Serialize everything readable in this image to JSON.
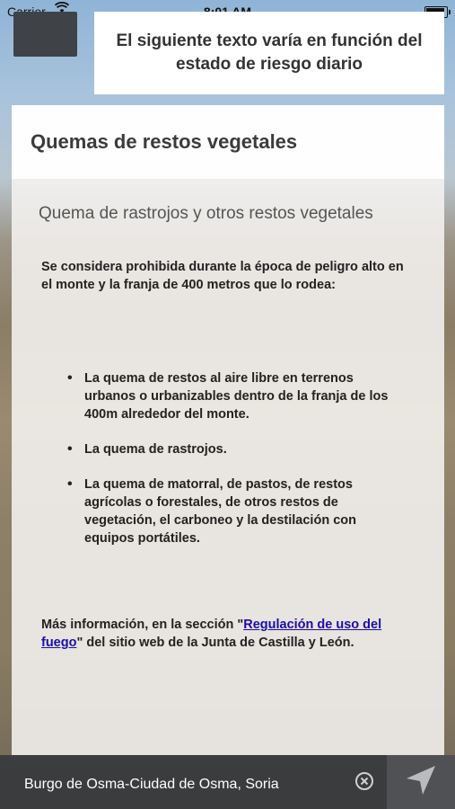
{
  "status_bar": {
    "carrier": "Carrier",
    "time": "8:01 AM"
  },
  "header": {
    "banner_text": "El siguiente texto varía en función del estado de riesgo diario"
  },
  "card": {
    "title": "Quemas de restos vegetales",
    "subtitle": "Quema de rastrojos y otros restos vegetales",
    "intro": "Se considera prohibida durante la época de peligro alto en el monte y la franja de 400 metros que lo rodea:",
    "bullets": [
      "La quema de restos al aire libre en terrenos urbanos o urbanizables dentro de la franja de los 400m alrededor del monte.",
      "La quema de rastrojos.",
      "La quema de matorral, de pastos, de restos agrícolas o forestales, de otros restos de vegetación, el carboneo y la destilación con equipos portátiles."
    ],
    "more_info": {
      "prefix": "Más información, en la sección \"",
      "link": "Regulación de uso del fuego",
      "suffix": "\" del sitio web de la Junta de Castilla y León."
    }
  },
  "bottom_bar": {
    "location": "Burgo de Osma-Ciudad de Osma, Soria"
  },
  "icons": {
    "wifi": "wifi-icon",
    "battery": "battery-icon",
    "clear": "clear-circle-icon",
    "navigate": "location-arrow-icon"
  }
}
